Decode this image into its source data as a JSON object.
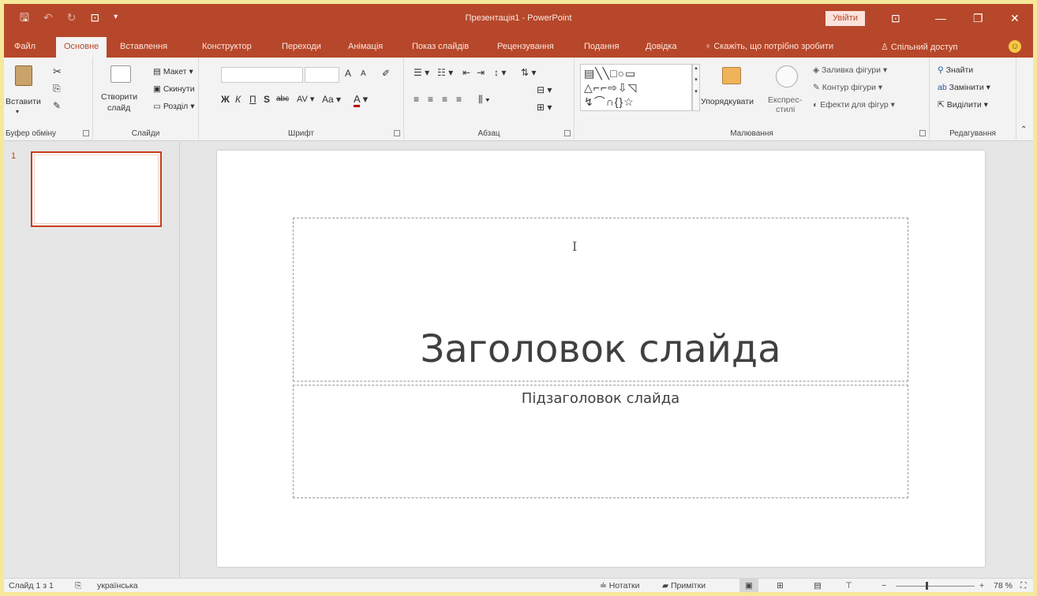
{
  "app": {
    "title": "Презентація1 - PowerPoint",
    "signin_label": "Увійти"
  },
  "qat": {
    "save": "🖫",
    "undo": "↶",
    "redo": "↻",
    "start": "⊡",
    "more": "▾"
  },
  "window_controls": {
    "display": "⊡",
    "minimize": "—",
    "restore": "❐",
    "close": "✕"
  },
  "tabs": [
    {
      "label": "Файл"
    },
    {
      "label": "Основне"
    },
    {
      "label": "Вставлення"
    },
    {
      "label": "Конструктор"
    },
    {
      "label": "Переходи"
    },
    {
      "label": "Анімація"
    },
    {
      "label": "Показ слайдів"
    },
    {
      "label": "Рецензування"
    },
    {
      "label": "Подання"
    },
    {
      "label": "Довідка"
    }
  ],
  "tell_me": "Скажіть, що потрібно зробити",
  "share": "Спільний доступ",
  "ribbon": {
    "clipboard": {
      "label": "Буфер обміну",
      "paste": "Вставити"
    },
    "slides": {
      "label": "Слайди",
      "new_slide_1": "Створити",
      "new_slide_2": "слайд",
      "layout": "Макет",
      "reset": "Скинути",
      "section": "Розділ"
    },
    "font": {
      "label": "Шрифт",
      "bold": "Ж",
      "italic": "К",
      "underline": "П",
      "shadow": "S",
      "strike": "abc",
      "case": "Aa",
      "color": "A",
      "grow": "A",
      "shrink": "A"
    },
    "paragraph": {
      "label": "Абзац"
    },
    "drawing": {
      "label": "Малювання",
      "arrange": "Упорядкувати",
      "quick_styles_1": "Експрес-",
      "quick_styles_2": "стилі",
      "fill": "Заливка фігури",
      "outline": "Контур фігури",
      "effects": "Ефекти для фігур"
    },
    "editing": {
      "label": "Редагування",
      "find": "Знайти",
      "replace": "Замінити",
      "select": "Виділити"
    }
  },
  "thumbnails": [
    {
      "number": "1"
    }
  ],
  "slide": {
    "title": "Заголовок слайда",
    "subtitle": "Підзаголовок слайда"
  },
  "status": {
    "slide_info": "Слайд 1 з 1",
    "language": "українська",
    "notes": "Нотатки",
    "comments": "Примітки",
    "zoom_minus": "−",
    "zoom_plus": "+",
    "zoom": "78 %",
    "zoom_fraction": 0.78
  }
}
